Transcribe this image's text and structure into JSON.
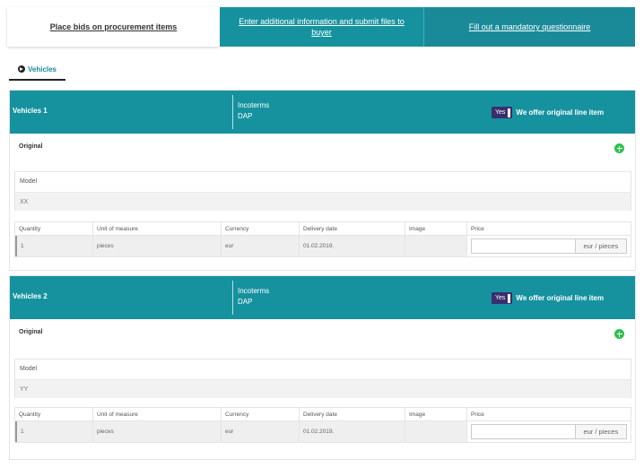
{
  "steps": {
    "bids": "Place bids on procurement items",
    "info": "Enter additional information and submit files to buyer",
    "questionnaire": "Fill out a mandatory questionnaire"
  },
  "category_tab": {
    "label": "Vehicles",
    "icon": "arrow-right-circle-icon"
  },
  "items": [
    {
      "title": "Vehicles 1",
      "incoterms_label": "Incoterms",
      "incoterms_value": "DAP",
      "toggle_label": "Yes",
      "offer_label": "We offer original line item",
      "original_label": "Original",
      "model_label": "Model",
      "model_value": "XX",
      "columns": [
        "Quantity",
        "Unit of measure",
        "Currency",
        "Delivery date",
        "Image",
        "Price"
      ],
      "row": {
        "quantity": "1",
        "unit": "pieces",
        "currency": "eur",
        "delivery_date": "01.02.2019.",
        "image": "",
        "price": "",
        "price_unit": "eur / pieces"
      }
    },
    {
      "title": "Vehicles 2",
      "incoterms_label": "Incoterms",
      "incoterms_value": "DAP",
      "toggle_label": "Yes",
      "offer_label": "We offer original line item",
      "original_label": "Original",
      "model_label": "Model",
      "model_value": "YY",
      "columns": [
        "Quantity",
        "Unit of measure",
        "Currency",
        "Delivery date",
        "Image",
        "Price"
      ],
      "row": {
        "quantity": "1",
        "unit": "pieces",
        "currency": "eur",
        "delivery_date": "01.02.2019.",
        "image": "",
        "price": "",
        "price_unit": "eur / pieces"
      }
    }
  ],
  "colors": {
    "teal": "#16929f",
    "toggle": "#3a2e6e",
    "add": "#2ec24e"
  }
}
